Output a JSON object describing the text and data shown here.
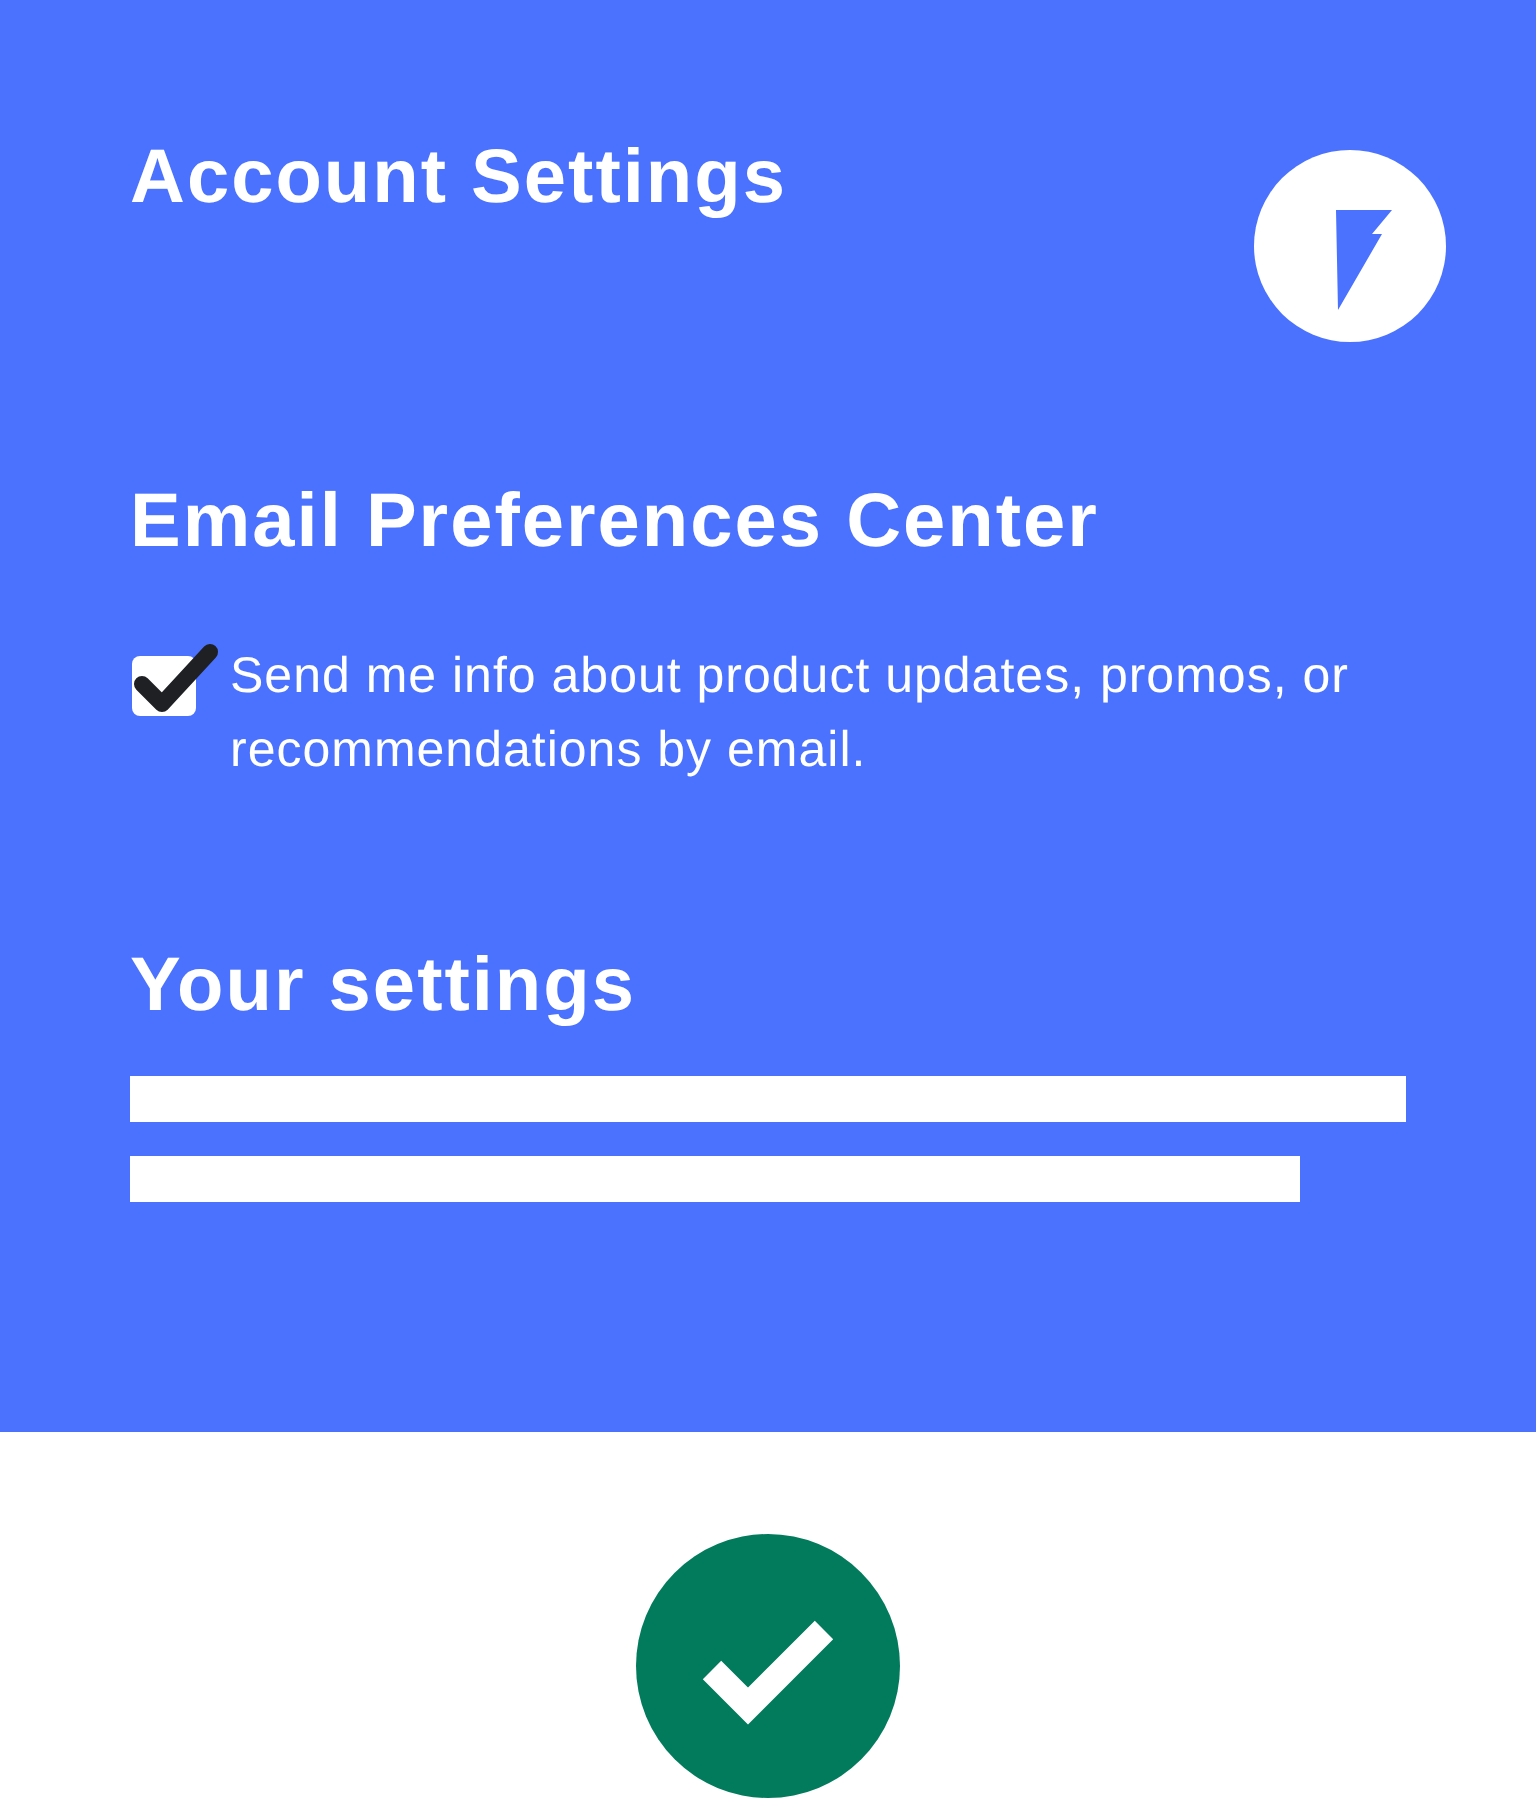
{
  "header": {
    "title": "Account Settings"
  },
  "section": {
    "title": "Email Preferences Center"
  },
  "option": {
    "label": "Send me info about product updates, promos, or recommendations by email.",
    "checked": true
  },
  "settings": {
    "title": "Your settings"
  },
  "status": {
    "kind": "success"
  }
}
